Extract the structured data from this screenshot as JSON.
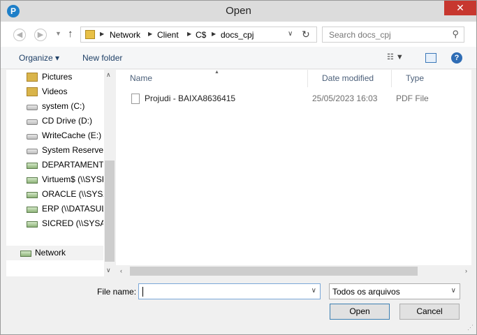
{
  "window": {
    "title": "Open",
    "close_glyph": "✕",
    "app_icon_letter": "P"
  },
  "navbar": {
    "breadcrumbs": [
      "Network",
      "Client",
      "C$",
      "docs_cpj"
    ],
    "search_placeholder": "Search docs_cpj"
  },
  "toolbar": {
    "organize_label": "Organize ▾",
    "new_folder_label": "New folder"
  },
  "sidebar": {
    "items": [
      {
        "label": "Pictures",
        "icon": "pictures-folder-icon"
      },
      {
        "label": "Videos",
        "icon": "videos-folder-icon"
      },
      {
        "label": "system (C:)",
        "icon": "drive-icon"
      },
      {
        "label": "CD Drive (D:)",
        "icon": "cd-drive-icon"
      },
      {
        "label": "WriteCache (E:)",
        "icon": "drive-icon"
      },
      {
        "label": "System Reserved",
        "icon": "drive-icon"
      },
      {
        "label": "DEPARTAMENTO",
        "icon": "network-drive-icon"
      },
      {
        "label": "Virtuem$ (\\\\SYSF",
        "icon": "network-drive-icon"
      },
      {
        "label": "ORACLE (\\\\SYSA",
        "icon": "network-drive-icon"
      },
      {
        "label": "ERP (\\\\DATASUL",
        "icon": "network-drive-icon"
      },
      {
        "label": "SICRED (\\\\SYSAP",
        "icon": "network-drive-icon"
      }
    ],
    "network_label": "Network"
  },
  "columns": {
    "name": "Name",
    "date": "Date modified",
    "type": "Type"
  },
  "files": [
    {
      "name": "Projudi - BAIXA8636415",
      "date": "25/05/2023 16:03",
      "type": "PDF File"
    }
  ],
  "bottom": {
    "file_name_label": "File name:",
    "file_name_value": "",
    "file_type_value": "Todos os arquivos",
    "open_label": "Open",
    "cancel_label": "Cancel"
  }
}
